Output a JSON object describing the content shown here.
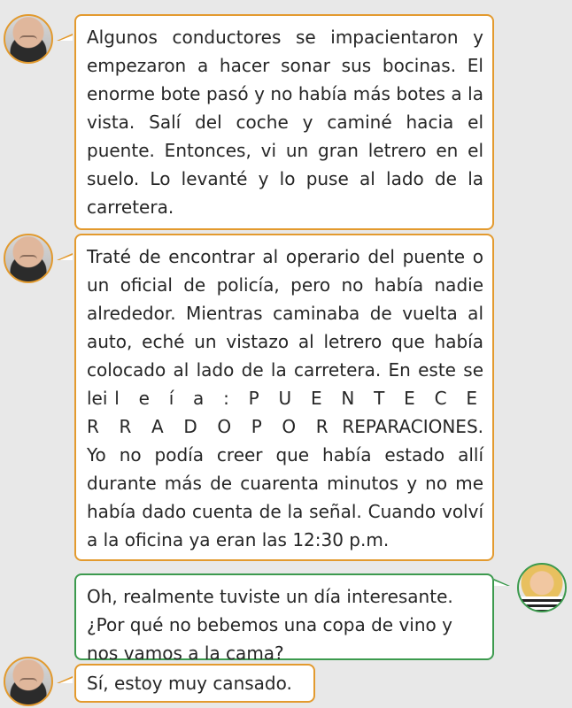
{
  "messages": [
    {
      "sender": "man",
      "text": "Algunos conductores se impacientaron y empezaron a hacer sonar sus bocinas. El enorme bote pasó y no había más botes a la vista. Salí del coche y caminé hacia el puente. Entonces, vi un gran letrero en el suelo. Lo levanté y lo puse al lado de la carretera."
    },
    {
      "sender": "man",
      "text": "Traté de encontrar al operario del puente o un oficial de policía, pero no había nadie alrededor. Mientras caminaba de vuelta al auto, eché un vistazo al letrero que había colocado al lado de la carretera. En este se lei",
      "spaced_text": "l e í a : P U E N T E   C E R R A D O   P O R",
      "tail_text": "REPARACIONES. Yo no podía creer que había estado allí durante más de cuarenta minutos y no me había dado cuenta de la señal. Cuando volví a la oficina ya eran las 12:30 p.m."
    },
    {
      "sender": "woman",
      "text": "Oh, realmente tuviste un día interesante. ¿Por qué no bebemos una copa de vino y nos vamos a la cama?"
    },
    {
      "sender": "man",
      "text": "Sí, estoy muy cansado."
    }
  ],
  "icons": {
    "man": "man-avatar-icon",
    "woman": "woman-avatar-icon"
  },
  "colors": {
    "orange": "#e39a2e",
    "green": "#3c9a4e",
    "background": "#e8e8e8"
  }
}
